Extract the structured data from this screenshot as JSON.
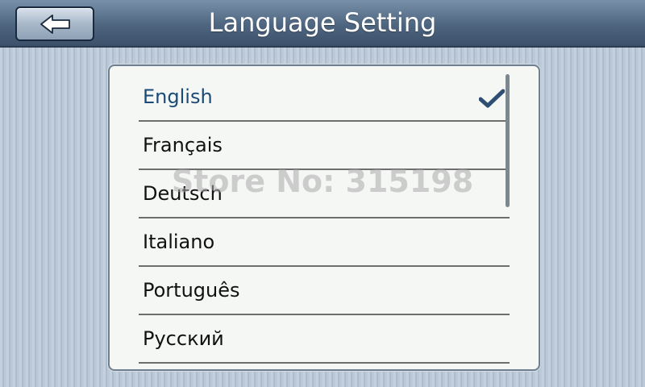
{
  "header": {
    "title": "Language Setting",
    "back_icon": "left-arrow-icon"
  },
  "languages": [
    {
      "label": "English",
      "selected": true
    },
    {
      "label": "Français",
      "selected": false
    },
    {
      "label": "Deutsch",
      "selected": false
    },
    {
      "label": "Italiano",
      "selected": false
    },
    {
      "label": "Português",
      "selected": false
    },
    {
      "label": "Русский",
      "selected": false
    }
  ],
  "selection_icon": "checkmark-icon",
  "watermark": "Store No: 315198",
  "colors": {
    "header": "#4e6580",
    "selected_text": "#1b4a78",
    "checkmark": "#2e4e73"
  }
}
